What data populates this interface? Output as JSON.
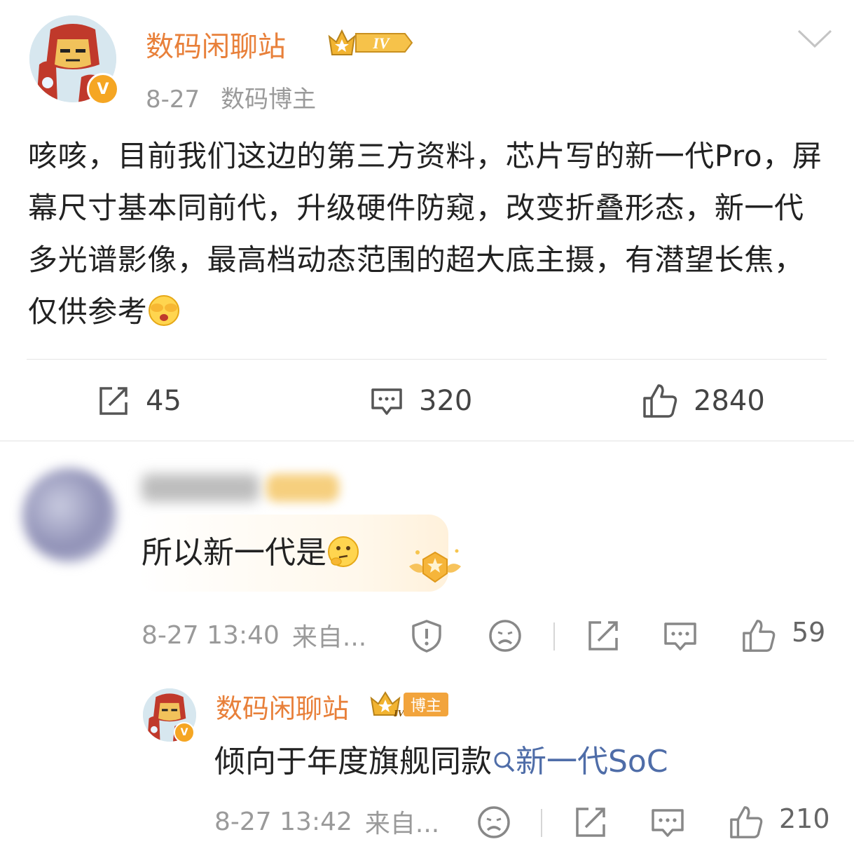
{
  "post": {
    "author": "数码闲聊站",
    "level_badge": "IV",
    "date": "8-27",
    "role": "数码博主",
    "verified_mark": "V",
    "body": "咳咳，目前我们这边的第三方资料，芯片写的新一代Pro，屏幕尺寸基本同前代，升级硬件防窥，改变折叠形态，新一代多光谱影像，最高档动态范围的超大底主摄，有潜望长焦，仅供参考",
    "body_emoji": "捂脸-emoji",
    "actions": {
      "repost_count": "45",
      "comment_count": "320",
      "like_count": "2840"
    }
  },
  "comment": {
    "text": "所以新一代是",
    "emoji": "思考-emoji",
    "time": "8-27 13:40",
    "source": "来自...",
    "like_count": "59"
  },
  "reply": {
    "author": "数码闲聊站",
    "tag": "博主",
    "level_badge": "IV",
    "verified_mark": "V",
    "text": "倾向于年度旗舰同款",
    "link_text": "新一代SoC",
    "time": "8-27 13:42",
    "source": "来自...",
    "like_count": "210"
  },
  "colors": {
    "author": "#e8803a",
    "link": "#4f6da8",
    "meta": "#9a9a9a",
    "badge_gold": "#f5a623"
  }
}
